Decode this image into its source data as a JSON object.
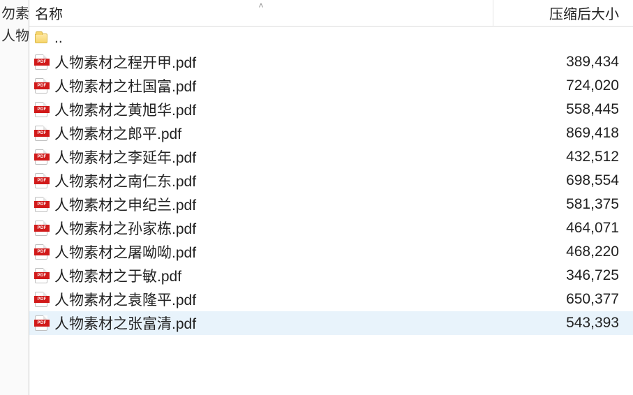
{
  "left_sliver": {
    "items": [
      "勿素",
      "人物"
    ]
  },
  "header": {
    "name_label": "名称",
    "size_label": "压缩后大小"
  },
  "parent_dir_label": "..",
  "files": [
    {
      "name": "人物素材之程开甲.pdf",
      "size": "389,434",
      "selected": false
    },
    {
      "name": "人物素材之杜国富.pdf",
      "size": "724,020",
      "selected": false
    },
    {
      "name": "人物素材之黄旭华.pdf",
      "size": "558,445",
      "selected": false
    },
    {
      "name": "人物素材之郎平.pdf",
      "size": "869,418",
      "selected": false
    },
    {
      "name": "人物素材之李延年.pdf",
      "size": "432,512",
      "selected": false
    },
    {
      "name": "人物素材之南仁东.pdf",
      "size": "698,554",
      "selected": false
    },
    {
      "name": "人物素材之申纪兰.pdf",
      "size": "581,375",
      "selected": false
    },
    {
      "name": "人物素材之孙家栋.pdf",
      "size": "464,071",
      "selected": false
    },
    {
      "name": "人物素材之屠呦呦.pdf",
      "size": "468,220",
      "selected": false
    },
    {
      "name": "人物素材之于敏.pdf",
      "size": "346,725",
      "selected": false
    },
    {
      "name": "人物素材之袁隆平.pdf",
      "size": "650,377",
      "selected": false
    },
    {
      "name": "人物素材之张富清.pdf",
      "size": "543,393",
      "selected": true
    }
  ]
}
